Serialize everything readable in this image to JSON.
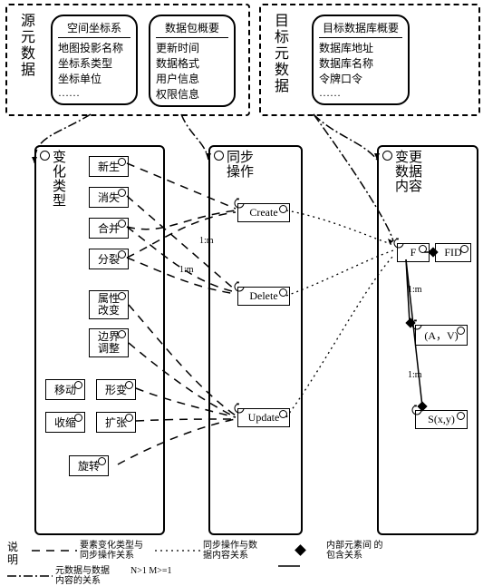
{
  "source_meta_label": "源元数据",
  "target_meta_label": "目标元数据",
  "src_box1": {
    "title": "空间坐标系",
    "lines": [
      "地图投影名称",
      "坐标系类型",
      "坐标单位",
      "……"
    ]
  },
  "src_box2": {
    "title": "数据包概要",
    "lines": [
      "更新时间",
      "数据格式",
      "用户信息",
      "权限信息"
    ]
  },
  "tgt_box": {
    "title": "目标数据库概要",
    "lines": [
      "数据库地址",
      "数据库名称",
      "令牌口令",
      "……"
    ]
  },
  "col1": {
    "title": "变\n化\n类\n型",
    "items": [
      "新生",
      "消失",
      "合并",
      "分裂",
      "属性\n改变",
      "边界\n调整",
      "移动",
      "形变",
      "收缩",
      "扩张",
      "旋转"
    ]
  },
  "col2": {
    "title": "同步\n操作",
    "items": [
      "Create",
      "Delete",
      "Update"
    ]
  },
  "col3": {
    "title": "变更\n数据\n内容",
    "items": [
      "F",
      "FID",
      "(A，V)",
      "S(x,y)"
    ]
  },
  "cards": {
    "c1": "1:m",
    "c2": "1:m",
    "c3": "1:m",
    "c4": "1:m"
  },
  "legend": {
    "label": "说\n明",
    "i1": "要素变化类型与\n同步操作关系",
    "i2": "同步操作与数\n据内容关系",
    "i3": "内部元素间\n的包含关系",
    "i4": "元数据与数据\n内容的关系",
    "tail": "N>1  M>=1"
  }
}
